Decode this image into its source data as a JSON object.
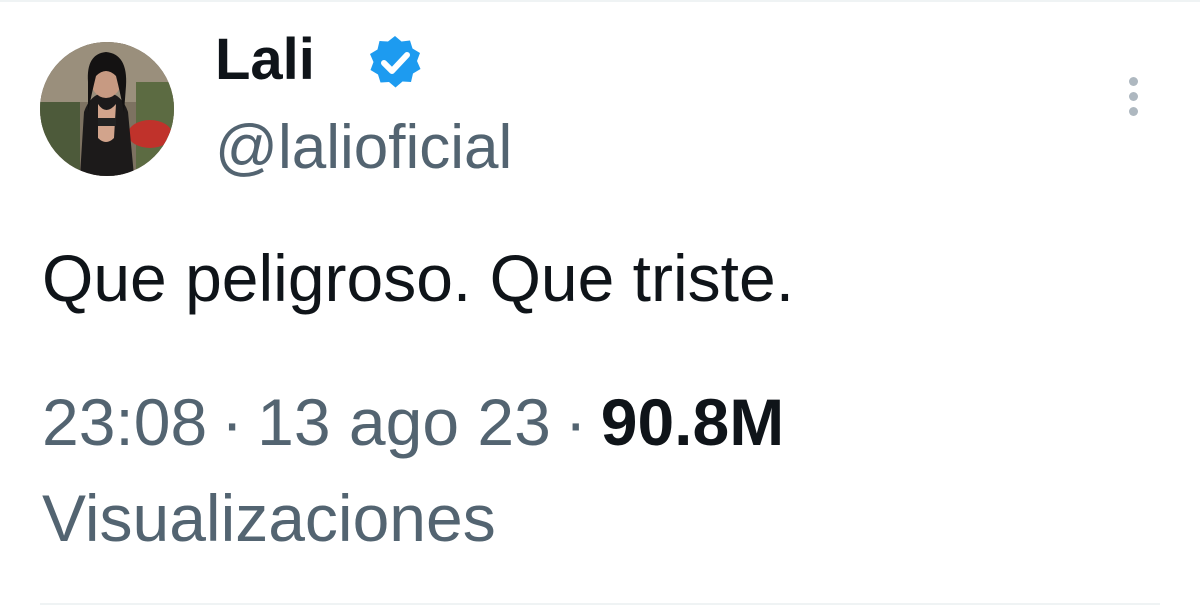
{
  "tweet": {
    "author": {
      "display_name": "Lali",
      "handle": "@lalioficial",
      "verified": true,
      "avatar_icon": "profile-photo",
      "verified_badge_color": "#1d9bf0"
    },
    "text": "Que peligroso. Que triste.",
    "meta": {
      "time": "23:08",
      "separator": "·",
      "date": "13 ago 23",
      "views_count": "90.8M",
      "views_label": "Visualizaciones"
    },
    "more_options_icon": "more-vertical-icon"
  },
  "colors": {
    "primary_text": "#0f1419",
    "secondary_text": "#536471",
    "divider": "#eff3f4"
  }
}
